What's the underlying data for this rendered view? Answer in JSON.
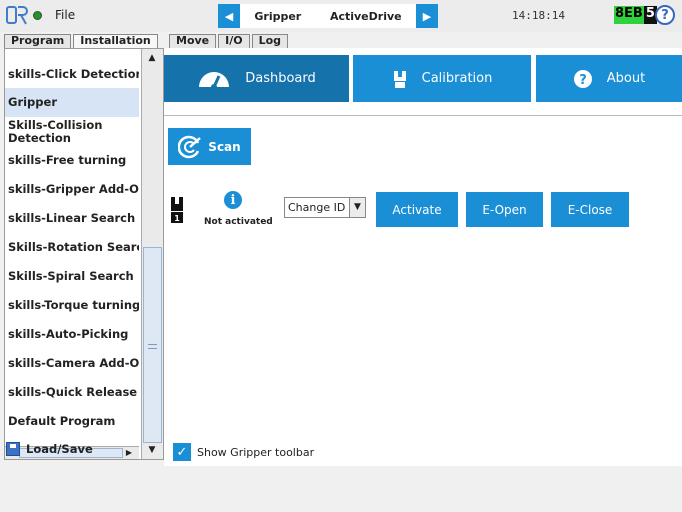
{
  "topbar": {
    "file_label": "File",
    "nav_prev_icon": "left-arrow",
    "nav_next_icon": "right-arrow",
    "program_label": "Gripper",
    "mode_label": "ActiveDrive",
    "time": "14:18:14",
    "robot_id_green": "8EB",
    "robot_id_dark": "5",
    "help_icon": "?"
  },
  "tabs_left": [
    "Program",
    "Installation"
  ],
  "tabs_right": [
    "Move",
    "I/O",
    "Log"
  ],
  "sidebar": {
    "items": [
      {
        "label": "skills-Click Detection"
      },
      {
        "label": "Gripper"
      },
      {
        "label": "Skills-Collision\nDetection"
      },
      {
        "label": "skills-Free turning"
      },
      {
        "label": "skills-Gripper Add-On"
      },
      {
        "label": "skills-Linear Search"
      },
      {
        "label": "Skills-Rotation Search"
      },
      {
        "label": "Skills-Spiral Search"
      },
      {
        "label": "skills-Torque turning"
      },
      {
        "label": "skills-Auto-Picking"
      },
      {
        "label": "skills-Camera Add-On"
      },
      {
        "label": "skills-Quick Release"
      },
      {
        "label": "Default Program"
      }
    ],
    "selected_index": 1,
    "load_save": "Load/Save"
  },
  "main": {
    "dashboard": "Dashboard",
    "calibration": "Calibration",
    "about": "About",
    "scan": "Scan",
    "status": "Not activated",
    "change_id": "Change ID",
    "activate": "Activate",
    "e_open": "E-Open",
    "e_close": "E-Close",
    "show_toolbar": "Show Gripper toolbar",
    "show_toolbar_checked": true
  },
  "colors": {
    "accent": "#1a8fd6",
    "accent_dark": "#1572aa",
    "id_green": "#2fd13d"
  }
}
